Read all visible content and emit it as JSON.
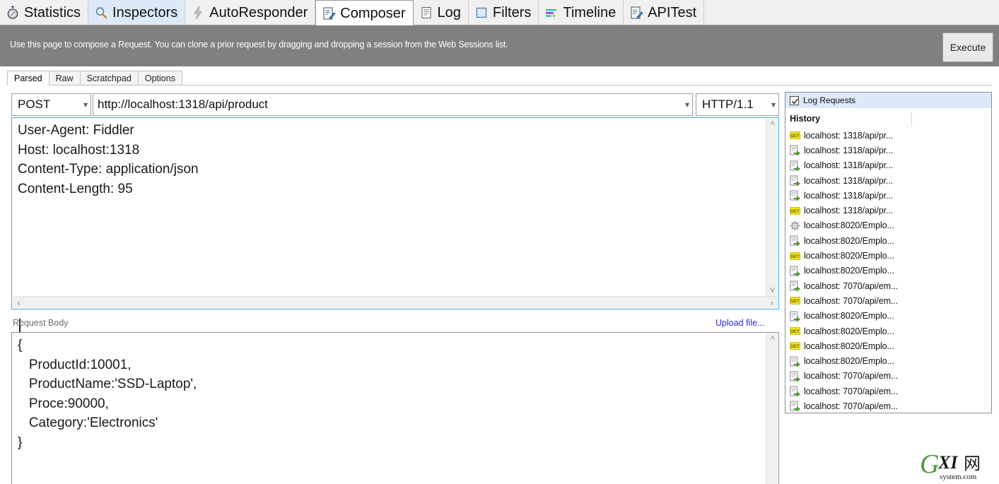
{
  "tabs": [
    {
      "label": "Statistics",
      "icon": "stopwatch-icon",
      "state": "normal"
    },
    {
      "label": "Inspectors",
      "icon": "magnifier-icon",
      "state": "highlight"
    },
    {
      "label": "AutoResponder",
      "icon": "lightning-icon",
      "state": "normal"
    },
    {
      "label": "Composer",
      "icon": "compose-pencil-icon",
      "state": "active"
    },
    {
      "label": "Log",
      "icon": "log-lines-icon",
      "state": "normal"
    },
    {
      "label": "Filters",
      "icon": "square-filter-icon",
      "state": "normal"
    },
    {
      "label": "Timeline",
      "icon": "timeline-bars-icon",
      "state": "normal"
    },
    {
      "label": "APITest",
      "icon": "apitest-pencil-icon",
      "state": "normal"
    }
  ],
  "infobar": {
    "text": "Use this page to compose a Request. You can clone a prior request by dragging and dropping a session from the Web Sessions list.",
    "execute_label": "Execute"
  },
  "subtabs": [
    {
      "label": "Parsed",
      "active": true
    },
    {
      "label": "Raw",
      "active": false
    },
    {
      "label": "Scratchpad",
      "active": false
    },
    {
      "label": "Options",
      "active": false
    }
  ],
  "request": {
    "method": "POST",
    "url": "http://localhost:1318/api/product",
    "http_version": "HTTP/1.1",
    "headers": "User-Agent: Fiddler\nHost: localhost:1318\nContent-Type: application/json\nContent-Length: 95",
    "body_label": "Request Body",
    "upload_label": "Upload file...",
    "body": "{\n   ProductId:10001,\n   ProductName:'SSD-Laptop',\n   Proce:90000,\n   Category:'Electronics'\n}"
  },
  "right_panel": {
    "log_requests_label": "Log Requests",
    "log_requests_checked": true,
    "history_label": "History",
    "history": [
      {
        "icon": "get-badge-icon",
        "label": "localhost: 1318/api/pr..."
      },
      {
        "icon": "post-arrow-icon",
        "label": "localhost: 1318/api/pr..."
      },
      {
        "icon": "post-arrow-icon",
        "label": "localhost: 1318/api/pr..."
      },
      {
        "icon": "post-arrow-icon",
        "label": "localhost: 1318/api/pr..."
      },
      {
        "icon": "post-arrow-icon",
        "label": "localhost: 1318/api/pr..."
      },
      {
        "icon": "get-badge-icon",
        "label": "localhost: 1318/api/pr..."
      },
      {
        "icon": "gear-icon",
        "label": "localhost:8020/Emplo..."
      },
      {
        "icon": "post-arrow-icon",
        "label": "localhost:8020/Emplo..."
      },
      {
        "icon": "get-badge-icon",
        "label": "localhost:8020/Emplo..."
      },
      {
        "icon": "post-arrow-icon",
        "label": "localhost:8020/Emplo..."
      },
      {
        "icon": "post-arrow-icon",
        "label": "localhost: 7070/api/em..."
      },
      {
        "icon": "get-badge-icon",
        "label": "localhost: 7070/api/em..."
      },
      {
        "icon": "post-arrow-icon",
        "label": "localhost:8020/Emplo..."
      },
      {
        "icon": "get-badge-icon",
        "label": "localhost:8020/Emplo..."
      },
      {
        "icon": "get-badge-icon",
        "label": "localhost:8020/Emplo..."
      },
      {
        "icon": "post-arrow-icon",
        "label": "localhost:8020/Emplo..."
      },
      {
        "icon": "post-arrow-icon",
        "label": "localhost: 7070/api/em..."
      },
      {
        "icon": "post-arrow-icon",
        "label": "localhost: 7070/api/em..."
      },
      {
        "icon": "post-arrow-icon",
        "label": "localhost: 7070/api/em..."
      }
    ]
  },
  "watermark": {
    "main": "GXI",
    "cjk": "网",
    "sub": "system.com"
  },
  "colors": {
    "infobar_bg": "#808080",
    "tab_active_bg": "#ffffff",
    "tab_highlight_bg": "#dce9f7",
    "focus_border": "#4ea6e8",
    "link": "#2b2bdd",
    "get_badge": "#f2e41d",
    "post_arrow": "#4caf2f",
    "watermark_green": "#4e9a3e"
  }
}
